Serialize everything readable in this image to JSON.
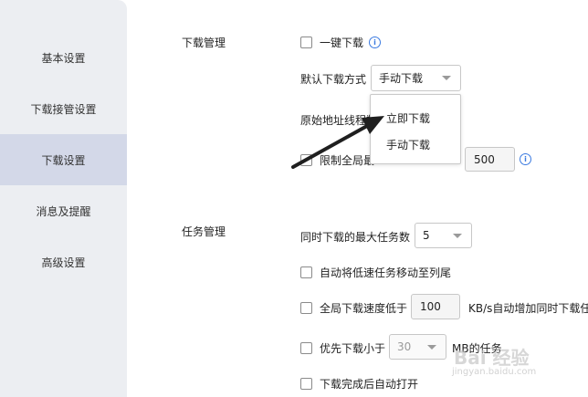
{
  "sidebar": {
    "items": [
      {
        "label": "基本设置"
      },
      {
        "label": "下载接管设置"
      },
      {
        "label": "下载设置"
      },
      {
        "label": "消息及提醒"
      },
      {
        "label": "高级设置"
      }
    ]
  },
  "download_management": {
    "section_label": "下载管理",
    "one_click_download": "一键下载",
    "default_method_label": "默认下载方式",
    "default_method_value": "手动下载",
    "original_thread_label": "原始地址线程数",
    "limit_global_label": "限制全局最",
    "limit_value": "500",
    "dropdown_options": [
      "立即下载",
      "手动下载"
    ]
  },
  "task_management": {
    "section_label": "任务管理",
    "max_tasks_label": "同时下载的最大任务数",
    "max_tasks_value": "5",
    "move_slow_label": "自动将低速任务移动至列尾",
    "global_speed_label": "全局下载速度低于",
    "global_speed_value": "100",
    "global_speed_suffix": "KB/s自动增加同时下载任",
    "priority_label": "优先下载小于",
    "priority_value": "30",
    "priority_suffix": "MB的任务",
    "auto_open_label": "下载完成后自动打开"
  },
  "watermark": {
    "brand": "Bai 经验",
    "url": "jingyan.baidu.com"
  }
}
